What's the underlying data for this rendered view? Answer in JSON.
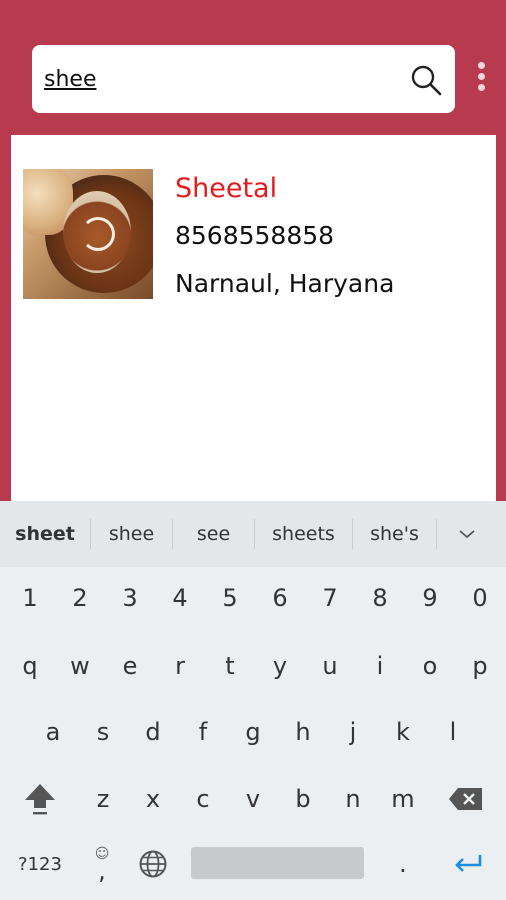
{
  "search": {
    "value": "shee"
  },
  "result": {
    "name": "Sheetal",
    "phone": "8568558858",
    "location": "Narnaul, Haryana"
  },
  "keyboard": {
    "suggestions": [
      "sheet",
      "shee",
      "see",
      "sheets",
      "she's"
    ],
    "row_numbers": [
      "1",
      "2",
      "3",
      "4",
      "5",
      "6",
      "7",
      "8",
      "9",
      "0"
    ],
    "row_q": [
      "q",
      "w",
      "e",
      "r",
      "t",
      "y",
      "u",
      "i",
      "o",
      "p"
    ],
    "row_a": [
      "a",
      "s",
      "d",
      "f",
      "g",
      "h",
      "j",
      "k",
      "l"
    ],
    "row_z": [
      "z",
      "x",
      "c",
      "v",
      "b",
      "n",
      "m"
    ],
    "symbols_key": "?123",
    "comma_key": ",",
    "period_key": ".",
    "emoji_key": "☺"
  },
  "colors": {
    "header_bg": "#b83a4f",
    "name_red": "#e11d1d",
    "enter_blue": "#1a8fe0"
  }
}
